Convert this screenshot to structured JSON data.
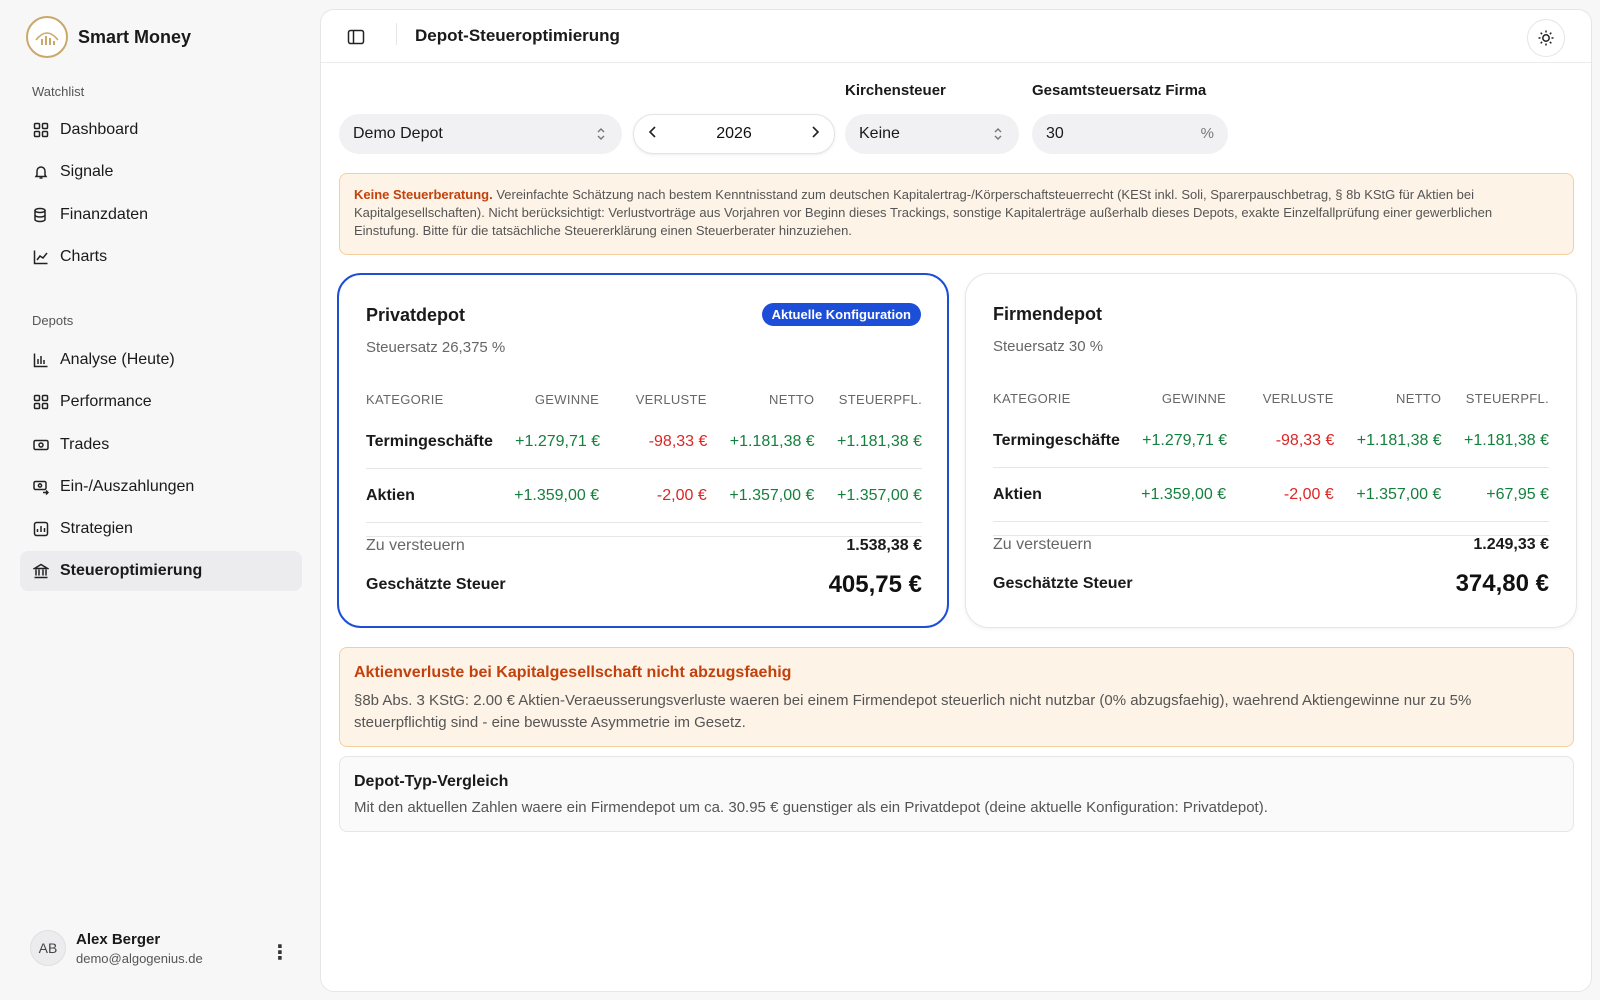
{
  "app": {
    "name": "Smart Money"
  },
  "sidebar": {
    "watchlist_label": "Watchlist",
    "watchlist_items": [
      {
        "label": "Dashboard",
        "icon": "grid-icon"
      },
      {
        "label": "Signale",
        "icon": "bell-icon"
      },
      {
        "label": "Finanzdaten",
        "icon": "database-icon"
      },
      {
        "label": "Charts",
        "icon": "line-chart-icon"
      }
    ],
    "depots_label": "Depots",
    "depot_items": [
      {
        "label": "Analyse (Heute)",
        "icon": "bar-chart-icon"
      },
      {
        "label": "Performance",
        "icon": "grid-icon"
      },
      {
        "label": "Trades",
        "icon": "money-icon"
      },
      {
        "label": "Ein-/Auszahlungen",
        "icon": "money-transfer-icon"
      },
      {
        "label": "Strategien",
        "icon": "chart-box-icon"
      },
      {
        "label": "Steueroptimierung",
        "icon": "bank-icon",
        "active": true
      }
    ]
  },
  "user": {
    "initials": "AB",
    "name": "Alex Berger",
    "email": "demo@algogenius.de",
    "menu": "⋮"
  },
  "header": {
    "title": "Depot-Steueroptimierung"
  },
  "controls": {
    "depot_select": "Demo Depot",
    "year": "2026",
    "kirchensteuer_label": "Kirchensteuer",
    "kirchensteuer_value": "Keine",
    "gesamtsteuersatz_label": "Gesamtsteuersatz Firma",
    "gesamtsteuersatz_value": "30",
    "gesamtsteuersatz_unit": "%"
  },
  "notice": {
    "bold": "Keine Steuerberatung.",
    "text": " Vereinfachte Schätzung nach bestem Kenntnisstand zum deutschen Kapitalertrag-/Körperschaftsteuerrecht (KESt inkl. Soli, Sparerpauschbetrag, § 8b KStG für Aktien bei Kapitalgesellschaften). Nicht berücksichtigt: Verlustvorträge aus Vorjahren vor Beginn dieses Trackings, sonstige Kapitalerträge außerhalb dieses Depots, exakte Einzelfallprüfung einer gewerblichen Einstufung. Bitte für die tatsächliche Steuererklärung einen Steuerberater hinzuziehen."
  },
  "table_headers": [
    "KATEGORIE",
    "GEWINNE",
    "VERLUSTE",
    "NETTO",
    "STEUERPFL."
  ],
  "privat": {
    "title": "Privatdepot",
    "badge": "Aktuelle Konfiguration",
    "rate": "Steuersatz 26,375 %",
    "rows": [
      {
        "kategorie": "Termingeschäfte",
        "gewinne": "+1.279,71 €",
        "verluste": "-98,33 €",
        "netto": "+1.181,38 €",
        "steuerpfl": "+1.181,38 €"
      },
      {
        "kategorie": "Aktien",
        "gewinne": "+1.359,00 €",
        "verluste": "-2,00 €",
        "netto": "+1.357,00 €",
        "steuerpfl": "+1.357,00 €"
      }
    ],
    "zu_versteuern_label": "Zu versteuern",
    "zu_versteuern": "1.538,38 €",
    "steuer_label": "Geschätzte Steuer",
    "steuer": "405,75 €"
  },
  "firma": {
    "title": "Firmendepot",
    "rate": "Steuersatz 30 %",
    "rows": [
      {
        "kategorie": "Termingeschäfte",
        "gewinne": "+1.279,71 €",
        "verluste": "-98,33 €",
        "netto": "+1.181,38 €",
        "steuerpfl": "+1.181,38 €"
      },
      {
        "kategorie": "Aktien",
        "gewinne": "+1.359,00 €",
        "verluste": "-2,00 €",
        "netto": "+1.357,00 €",
        "steuerpfl": "+67,95 €"
      }
    ],
    "zu_versteuern_label": "Zu versteuern",
    "zu_versteuern": "1.249,33 €",
    "steuer_label": "Geschätzte Steuer",
    "steuer": "374,80 €"
  },
  "warning": {
    "title": "Aktienverluste bei Kapitalgesellschaft nicht abzugsfaehig",
    "text": "§8b Abs. 3 KStG: 2.00 € Aktien-Veraeusserungsverluste waeren bei einem Firmendepot steuerlich nicht nutzbar (0% abzugsfaehig), waehrend Aktiengewinne nur zu 5% steuerpflichtig sind - eine bewusste Asymmetrie im Gesetz."
  },
  "comparison": {
    "title": "Depot-Typ-Vergleich",
    "text": "Mit den aktuellen Zahlen waere ein Firmendepot um ca. 30.95 € guenstiger als ein Privatdepot (deine aktuelle Konfiguration: Privatdepot)."
  },
  "colors": {
    "accent": "#1d4ed8",
    "positive": "#15803d",
    "negative": "#dc2626",
    "warning": "#c2410c"
  }
}
